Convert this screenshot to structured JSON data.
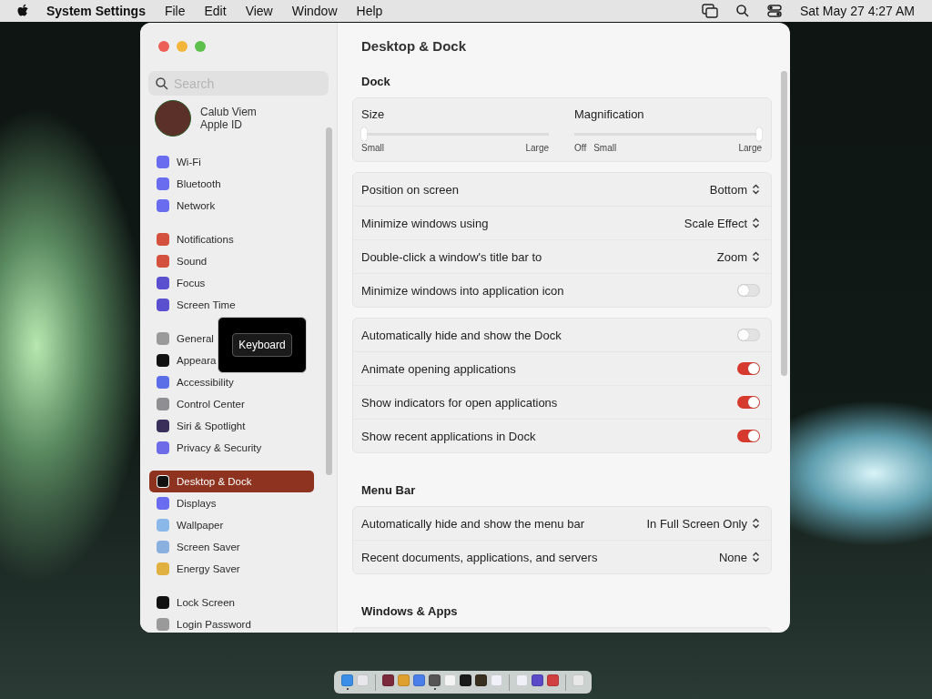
{
  "menu_bar": {
    "app_name": "System Settings",
    "menus": [
      "File",
      "Edit",
      "View",
      "Window",
      "Help"
    ],
    "clock": "Sat May 27  4:27 AM"
  },
  "window": {
    "title": "Desktop & Dock"
  },
  "sidebar": {
    "search": {
      "placeholder": "Search"
    },
    "account": {
      "name": "Calub Viem",
      "subtitle": "Apple ID"
    },
    "groups": [
      {
        "items": [
          {
            "label": "Wi-Fi",
            "color": "#6a6cf0",
            "selected": false
          },
          {
            "label": "Bluetooth",
            "color": "#6a6cf0",
            "selected": false
          },
          {
            "label": "Network",
            "color": "#6a6cf0",
            "selected": false
          }
        ]
      },
      {
        "items": [
          {
            "label": "Notifications",
            "color": "#d4513f",
            "selected": false
          },
          {
            "label": "Sound",
            "color": "#d4513f",
            "selected": false
          },
          {
            "label": "Focus",
            "color": "#5a4fcf",
            "selected": false
          },
          {
            "label": "Screen Time",
            "color": "#5a4fcf",
            "selected": false
          }
        ]
      },
      {
        "items": [
          {
            "label": "General",
            "color": "#9a9a9a",
            "selected": false
          },
          {
            "label": "Appeara",
            "color": "#111111",
            "selected": false
          },
          {
            "label": "Accessibility",
            "color": "#5b6ee8",
            "selected": false
          },
          {
            "label": "Control Center",
            "color": "#8e8e93",
            "selected": false
          },
          {
            "label": "Siri & Spotlight",
            "color": "#3a2f5a",
            "selected": false
          },
          {
            "label": "Privacy & Security",
            "color": "#6e6be8",
            "selected": false
          }
        ]
      },
      {
        "items": [
          {
            "label": "Desktop & Dock",
            "color": "#111111",
            "selected": true
          },
          {
            "label": "Displays",
            "color": "#6a6cf0",
            "selected": false
          },
          {
            "label": "Wallpaper",
            "color": "#8ab8e8",
            "selected": false
          },
          {
            "label": "Screen Saver",
            "color": "#8ab0e0",
            "selected": false
          },
          {
            "label": "Energy Saver",
            "color": "#e0b040",
            "selected": false
          }
        ]
      },
      {
        "items": [
          {
            "label": "Lock Screen",
            "color": "#111111",
            "selected": false
          },
          {
            "label": "Login Password",
            "color": "#9a9a9a",
            "selected": false
          }
        ]
      }
    ]
  },
  "tooltip": {
    "label": "Keyboard"
  },
  "sections": [
    {
      "title": "Dock",
      "cards": [
        {
          "kind": "sliders",
          "sliders": [
            {
              "label": "Size",
              "level": 0,
              "start_labels": [
                "Small"
              ],
              "end_label": "Large"
            },
            {
              "label": "Magnification",
              "level": 1,
              "start_labels": [
                "Off",
                "Small"
              ],
              "end_label": "Large"
            }
          ]
        },
        {
          "kind": "rows",
          "rows": [
            {
              "kind": "popup",
              "label": "Position on screen",
              "value": "Bottom"
            },
            {
              "kind": "popup",
              "label": "Minimize windows using",
              "value": "Scale Effect"
            },
            {
              "kind": "popup",
              "label": "Double-click a window's title bar to",
              "value": "Zoom"
            },
            {
              "kind": "toggle",
              "label": "Minimize windows into application icon",
              "on": false
            }
          ]
        },
        {
          "kind": "rows",
          "rows": [
            {
              "kind": "toggle",
              "label": "Automatically hide and show the Dock",
              "on": false
            },
            {
              "kind": "toggle",
              "label": "Animate opening applications",
              "on": true
            },
            {
              "kind": "toggle",
              "label": "Show indicators for open applications",
              "on": true
            },
            {
              "kind": "toggle",
              "label": "Show recent applications in Dock",
              "on": true
            }
          ]
        }
      ]
    },
    {
      "title": "Menu Bar",
      "cards": [
        {
          "kind": "rows",
          "rows": [
            {
              "kind": "popup",
              "label": "Automatically hide and show the menu bar",
              "value": "In Full Screen Only"
            },
            {
              "kind": "popup",
              "label": "Recent documents, applications, and servers",
              "value": "None"
            }
          ]
        }
      ]
    },
    {
      "title": "Windows & Apps",
      "cards": [
        {
          "kind": "clipped"
        }
      ]
    }
  ],
  "dock": {
    "groups": [
      {
        "apps": [
          {
            "color": "#3a8ee8",
            "running": true
          },
          {
            "color": "#e8e8ec",
            "running": false
          }
        ]
      },
      {
        "apps": [
          {
            "color": "#7a2a3a",
            "running": false
          },
          {
            "color": "#e0a030",
            "running": false
          },
          {
            "color": "#4a7ee8",
            "running": false
          },
          {
            "color": "#555555",
            "running": true
          },
          {
            "color": "#f4f4f4",
            "running": false
          },
          {
            "color": "#1a1a1a",
            "running": false
          },
          {
            "color": "#3a3020",
            "running": false
          },
          {
            "color": "#f0f0f8",
            "running": false
          }
        ]
      },
      {
        "apps": [
          {
            "color": "#f0f0f8",
            "running": false
          },
          {
            "color": "#5a4ac8",
            "running": false
          },
          {
            "color": "#d04040",
            "running": false
          }
        ]
      },
      {
        "apps": [
          {
            "color": "#e8e8e8",
            "running": false
          }
        ]
      }
    ]
  }
}
